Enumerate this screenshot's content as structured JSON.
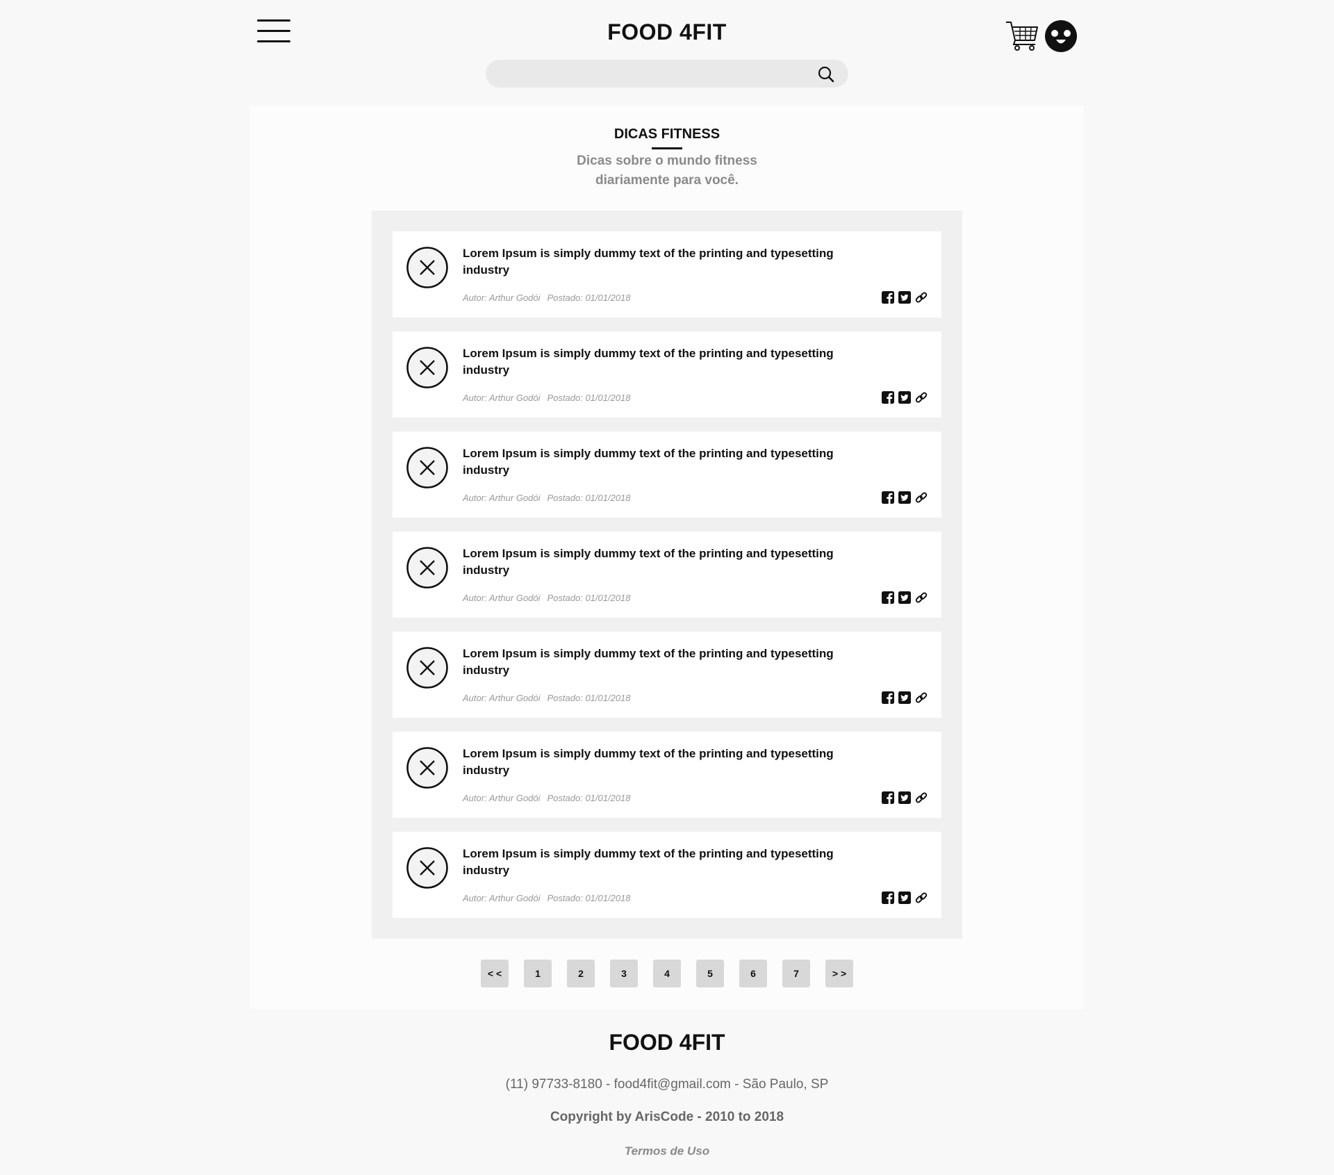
{
  "header": {
    "brand": "FOOD 4FIT",
    "search_placeholder": "",
    "icons": [
      "hamburger-menu-icon",
      "cart-icon",
      "user-avatar-icon",
      "search-icon"
    ]
  },
  "section": {
    "title": "DICAS FITNESS",
    "subtitle_line1": "Dicas sobre o mundo fitness",
    "subtitle_line2": "diariamente para você."
  },
  "posts": [
    {
      "title": "Lorem Ipsum is simply dummy text of the printing and typesetting industry",
      "author": "Autor: Arthur Godói",
      "date": "Postado: 01/01/2018"
    },
    {
      "title": "Lorem Ipsum is simply dummy text of the printing and typesetting industry",
      "author": "Autor: Arthur Godói",
      "date": "Postado: 01/01/2018"
    },
    {
      "title": "Lorem Ipsum is simply dummy text of the printing and typesetting industry",
      "author": "Autor: Arthur Godói",
      "date": "Postado: 01/01/2018"
    },
    {
      "title": "Lorem Ipsum is simply dummy text of the printing and typesetting industry",
      "author": "Autor: Arthur Godói",
      "date": "Postado: 01/01/2018"
    },
    {
      "title": "Lorem Ipsum is simply dummy text of the printing and typesetting industry",
      "author": "Autor: Arthur Godói",
      "date": "Postado: 01/01/2018"
    },
    {
      "title": "Lorem Ipsum is simply dummy text of the printing and typesetting industry",
      "author": "Autor: Arthur Godói",
      "date": "Postado: 01/01/2018"
    },
    {
      "title": "Lorem Ipsum is simply dummy text of the printing and typesetting industry",
      "author": "Autor: Arthur Godói",
      "date": "Postado: 01/01/2018"
    }
  ],
  "pagination": {
    "prev": "< <",
    "pages": [
      "1",
      "2",
      "3",
      "4",
      "5",
      "6",
      "7"
    ],
    "next": "> >"
  },
  "footer": {
    "brand": "FOOD 4FIT",
    "contact": "(11) 97733-8180 - food4fit@gmail.com - São Paulo, SP",
    "copyright": "Copyright by ArisCode - 2010 to 2018",
    "terms": "Termos de Uso"
  }
}
